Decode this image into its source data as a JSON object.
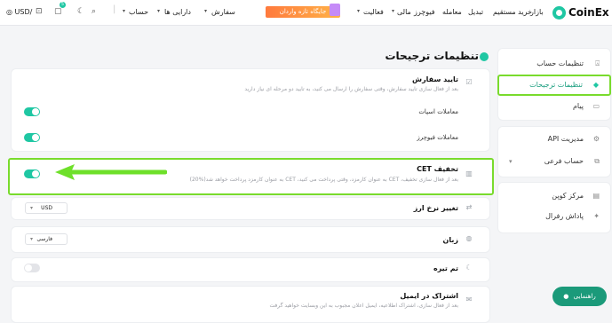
{
  "topbar": {
    "brand": "CoinEx",
    "nav": [
      "بازار",
      "خرید مستقیم",
      "تبدیل",
      "معامله",
      "فیوچرز",
      "مالی",
      "فعالیت"
    ],
    "promo": "جایگاه تازه واردان",
    "orders": "سفارش",
    "assets": "دارایی ها",
    "account": "حساب",
    "currency": "USD/",
    "notif_count": "5"
  },
  "sidebar": {
    "group1": [
      "تنظیمات حساب",
      "تنظیمات ترجیحات",
      "پیام"
    ],
    "group2": [
      "مدیریت API",
      "حساب فرعی"
    ],
    "group3": [
      "مرکز کوپن",
      "پاداش رفرال"
    ]
  },
  "main": {
    "title": "تنظیمات ترجیحات",
    "order_confirm": {
      "title": "تایید سفارش",
      "desc": "بعد از فعال سازی تایید سفارش، وقتی سفارش را ارسال می کنید، به تایید دو مرحله ای نیاز دارید",
      "spot": "معاملات اسپات",
      "futures": "معاملات فیوچرز"
    },
    "cet": {
      "title": "تخفیف CET",
      "desc": "بعد از فعال سازی تخفیف، CET به عنوان کارمزد، وقتی پرداخت می کنید، CET به عنوان کارمزد پرداخت خواهد شد(%20)"
    },
    "rate": {
      "title": "تغییر نرخ ارز",
      "value": "USD"
    },
    "language": {
      "title": "زبان",
      "value": "فارسی"
    },
    "dark": {
      "title": "تم تیره"
    },
    "email": {
      "title": "اشتراک در ایمیل",
      "desc": "بعد از فعال سازی، اشتراک اطلاعیه، ایمیل اعلان مجبوب به این وبسایت خواهید گرفت"
    }
  },
  "help": "راهنمایی",
  "colors": {
    "accent": "#1fc7a3",
    "highlight": "#79db2d",
    "arrow": "#6ee02a"
  }
}
